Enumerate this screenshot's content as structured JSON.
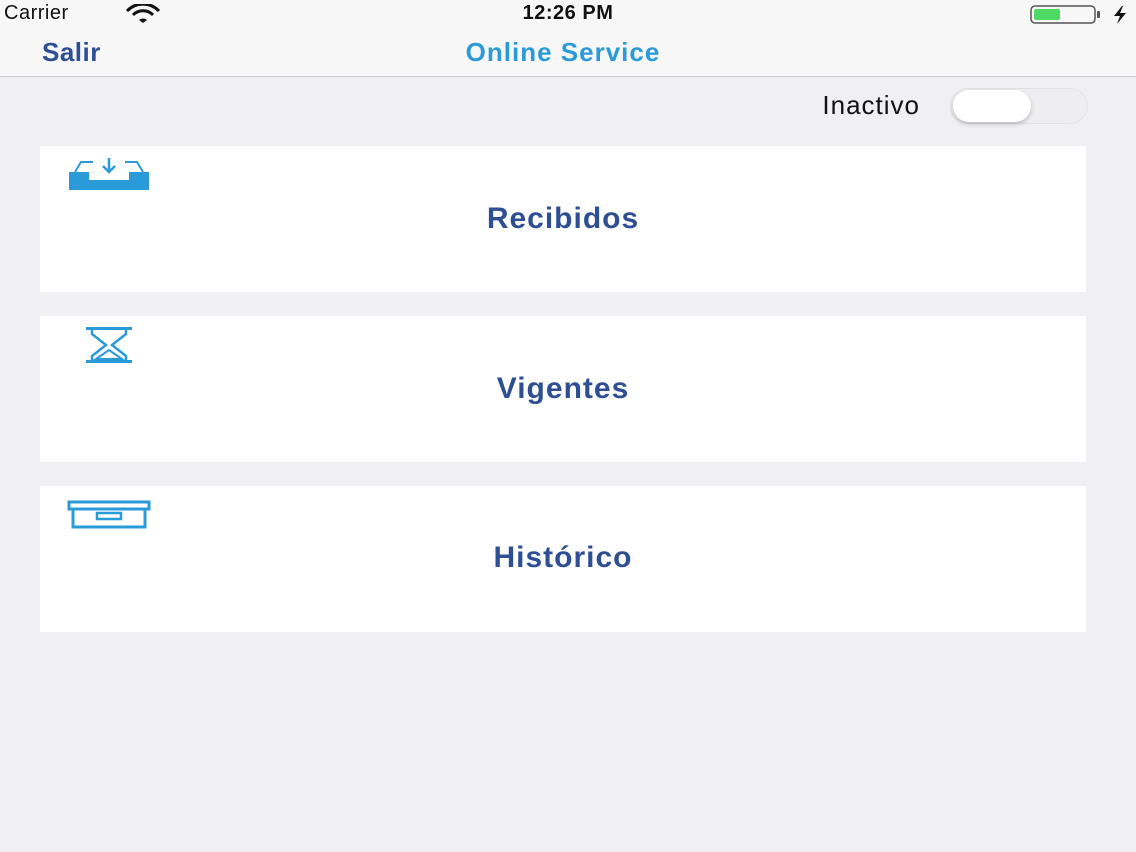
{
  "status_bar": {
    "carrier": "Carrier",
    "time": "12:26 PM",
    "battery_level": 0.45,
    "battery_color": "#4cd964"
  },
  "nav": {
    "back_label": "Salir",
    "title": "Online Service",
    "back_color": "#2f4f95",
    "title_color": "#2a9ad8"
  },
  "toggle": {
    "label": "Inactivo",
    "on": false
  },
  "menu": [
    {
      "label": "Recibidos",
      "icon": "inbox-download-icon"
    },
    {
      "label": "Vigentes",
      "icon": "hourglass-icon"
    },
    {
      "label": "Histórico",
      "icon": "archive-box-icon"
    }
  ],
  "colors": {
    "background": "#efeff4",
    "card_text": "#2f4f95",
    "icon_blue": "#2a9ad8"
  }
}
